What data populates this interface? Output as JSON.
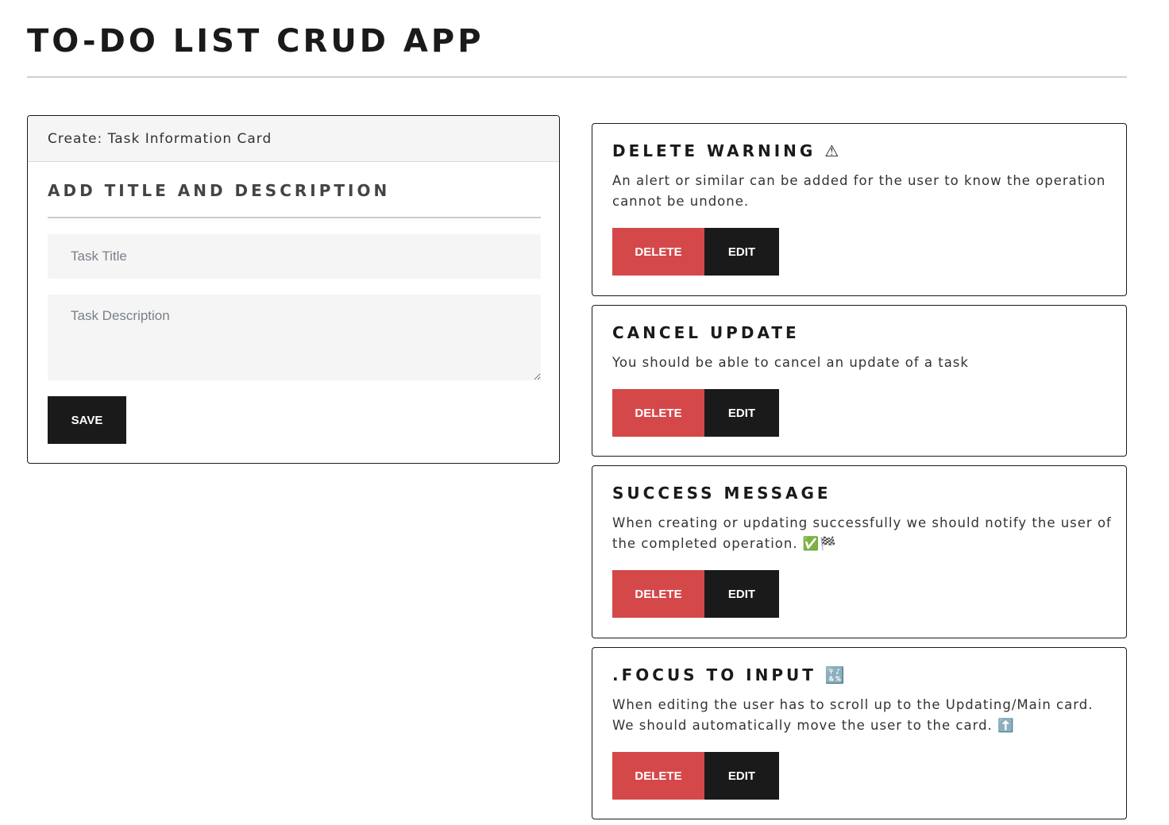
{
  "app": {
    "title": "TO-DO LIST CRUD APP"
  },
  "create_card": {
    "header": "Create: Task Information Card",
    "heading": "ADD TITLE AND DESCRIPTION",
    "title_placeholder": "Task Title",
    "title_value": "",
    "description_placeholder": "Task Description",
    "description_value": "",
    "save_label": "SAVE"
  },
  "tasks": [
    {
      "title": "DELETE WARNING ⚠",
      "description": "An alert or similar can be added for the user to know the operation cannot be undone.",
      "delete_label": "DELETE",
      "edit_label": "EDIT"
    },
    {
      "title": "CANCEL UPDATE",
      "description": "You should be able to cancel an update of a task",
      "delete_label": "DELETE",
      "edit_label": "EDIT"
    },
    {
      "title": "SUCCESS MESSAGE",
      "description": "When creating or updating successfully we should notify the user of the completed operation. ✅🏁",
      "delete_label": "DELETE",
      "edit_label": "EDIT"
    },
    {
      "title": ".FOCUS TO INPUT 🔣",
      "description": "When editing the user has to scroll up to the Updating/Main card. We should automatically move the user to the card. ⬆️",
      "delete_label": "DELETE",
      "edit_label": "EDIT"
    }
  ],
  "colors": {
    "delete": "#d5484a",
    "dark": "#1a1a1a",
    "input_bg": "#f5f5f6"
  }
}
